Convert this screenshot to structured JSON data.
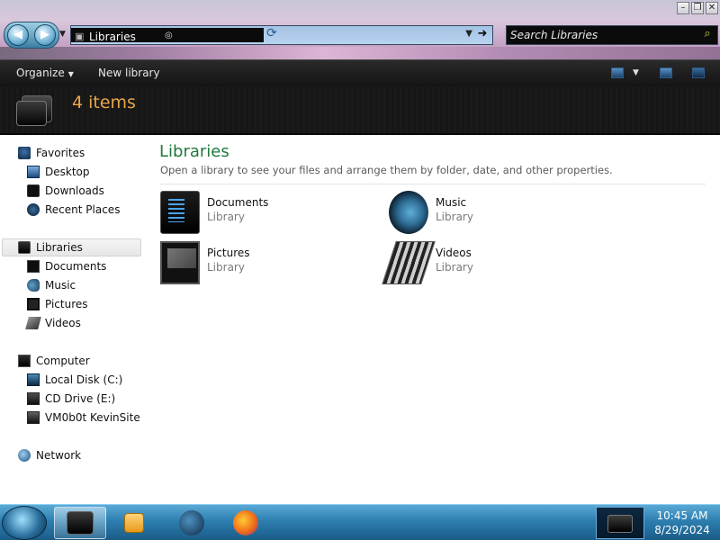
{
  "window": {
    "address_path": "Libraries",
    "search_placeholder": "Search Libraries",
    "controls": [
      "minimize",
      "maximize",
      "close"
    ]
  },
  "toolbar": {
    "organize_label": "Organize",
    "new_library_label": "New library"
  },
  "details": {
    "item_count": "4 items"
  },
  "sidebar": {
    "favorites": {
      "label": "Favorites",
      "items": [
        {
          "label": "Desktop",
          "icon": "desktop-icon"
        },
        {
          "label": "Downloads",
          "icon": "downloads-icon"
        },
        {
          "label": "Recent Places",
          "icon": "recent-places-icon"
        }
      ]
    },
    "libraries": {
      "label": "Libraries",
      "items": [
        {
          "label": "Documents",
          "icon": "documents-icon"
        },
        {
          "label": "Music",
          "icon": "music-icon"
        },
        {
          "label": "Pictures",
          "icon": "pictures-icon"
        },
        {
          "label": "Videos",
          "icon": "videos-icon"
        }
      ]
    },
    "computer": {
      "label": "Computer",
      "items": [
        {
          "label": "Local Disk (C:)",
          "icon": "local-disk-icon"
        },
        {
          "label": "CD Drive (E:)",
          "icon": "cd-drive-icon"
        },
        {
          "label": "VM0b0t KevinSite",
          "icon": "network-drive-icon"
        }
      ]
    },
    "network": {
      "label": "Network"
    }
  },
  "main": {
    "title": "Libraries",
    "subtitle": "Open a library to see your files and arrange them by folder, date, and other properties.",
    "libraries": [
      {
        "name": "Documents",
        "type": "Library",
        "icon": "documents-library-icon"
      },
      {
        "name": "Music",
        "type": "Library",
        "icon": "music-library-icon"
      },
      {
        "name": "Pictures",
        "type": "Library",
        "icon": "pictures-library-icon"
      },
      {
        "name": "Videos",
        "type": "Library",
        "icon": "videos-library-icon"
      }
    ]
  },
  "taskbar": {
    "time": "10:45 AM",
    "date": "8/29/2024"
  }
}
